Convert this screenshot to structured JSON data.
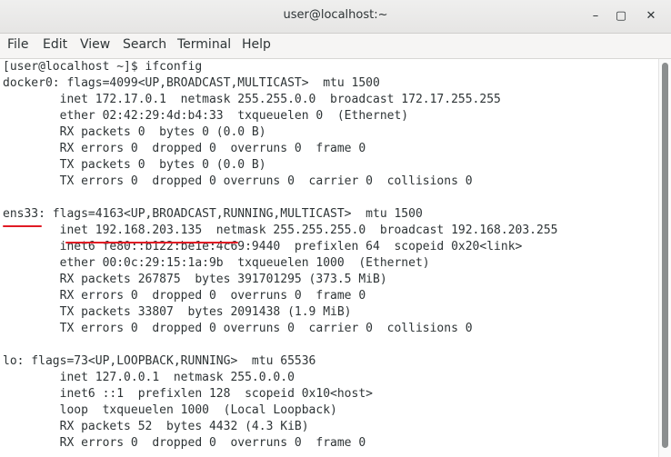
{
  "window": {
    "title": "user@localhost:~",
    "minimize_icon": "minimize-icon",
    "maximize_icon": "maximize-icon",
    "close_icon": "close-icon"
  },
  "menu": [
    "File",
    "Edit",
    "View",
    "Search",
    "Terminal",
    "Help"
  ],
  "terminal": {
    "lines": [
      "[user@localhost ~]$ ifconfig",
      "docker0: flags=4099<UP,BROADCAST,MULTICAST>  mtu 1500",
      "        inet 172.17.0.1  netmask 255.255.0.0  broadcast 172.17.255.255",
      "        ether 02:42:29:4d:b4:33  txqueuelen 0  (Ethernet)",
      "        RX packets 0  bytes 0 (0.0 B)",
      "        RX errors 0  dropped 0  overruns 0  frame 0",
      "        TX packets 0  bytes 0 (0.0 B)",
      "        TX errors 0  dropped 0 overruns 0  carrier 0  collisions 0",
      "",
      "ens33: flags=4163<UP,BROADCAST,RUNNING,MULTICAST>  mtu 1500",
      "        inet 192.168.203.135  netmask 255.255.255.0  broadcast 192.168.203.255",
      "        inet6 fe80::b122:be1e:4c69:9440  prefixlen 64  scopeid 0x20<link>",
      "        ether 00:0c:29:15:1a:9b  txqueuelen 1000  (Ethernet)",
      "        RX packets 267875  bytes 391701295 (373.5 MiB)",
      "        RX errors 0  dropped 0  overruns 0  frame 0",
      "        TX packets 33807  bytes 2091438 (1.9 MiB)",
      "        TX errors 0  dropped 0 overruns 0  carrier 0  collisions 0",
      "",
      "lo: flags=73<UP,LOOPBACK,RUNNING>  mtu 65536",
      "        inet 127.0.0.1  netmask 255.0.0.0",
      "        inet6 ::1  prefixlen 128  scopeid 0x10<host>",
      "        loop  txqueuelen 1000  (Local Loopback)",
      "        RX packets 52  bytes 4432 (4.3 KiB)",
      "        RX errors 0  dropped 0  overruns 0  frame 0"
    ]
  },
  "annotation_color": "#e01b24"
}
